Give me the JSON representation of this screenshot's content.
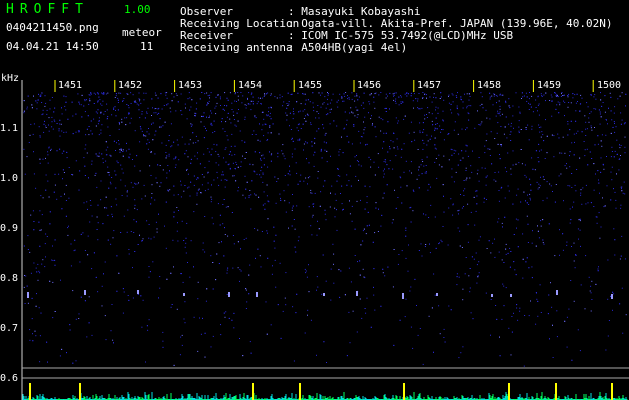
{
  "app": {
    "title": "HROFFT",
    "version": "1.00"
  },
  "file": {
    "name": "0404211450.png",
    "datetime": "04.04.21 14:50"
  },
  "meteor": {
    "label": "meteor",
    "count": "11"
  },
  "info": [
    {
      "label": "Observer",
      "value": ": Masayuki Kobayashi"
    },
    {
      "label": "Receiving Location",
      "value": ": Ogata-vill. Akita-Pref. JAPAN (139.96E, 40.02N)"
    },
    {
      "label": "Receiver",
      "value": ": ICOM IC-575 53.7492(@LCD)MHz USB"
    },
    {
      "label": "Receiving antenna",
      "value": ": A504HB(yagi 4el)"
    }
  ],
  "axis": {
    "unit": "kHz",
    "y_ticks": [
      "1.1",
      "1.0",
      "0.9",
      "0.8",
      "0.7",
      "0.6"
    ],
    "time_labels": [
      "1451",
      "1452",
      "1453",
      "1454",
      "1455",
      "1456",
      "1457",
      "1458",
      "1459",
      "1500"
    ]
  },
  "colors": {
    "background": "#000000",
    "title": "#00ff00",
    "text": "#ffffff",
    "spectrum_noise": "#2a2ad8",
    "spectrum_bright": "#6e6eff",
    "meteor_echo": "#9a9aff",
    "marker_yellow": "#ffff00",
    "baseline_cyan": "#00e0e0",
    "baseline_green": "#00ff60",
    "frame": "#d0d0d0"
  }
}
